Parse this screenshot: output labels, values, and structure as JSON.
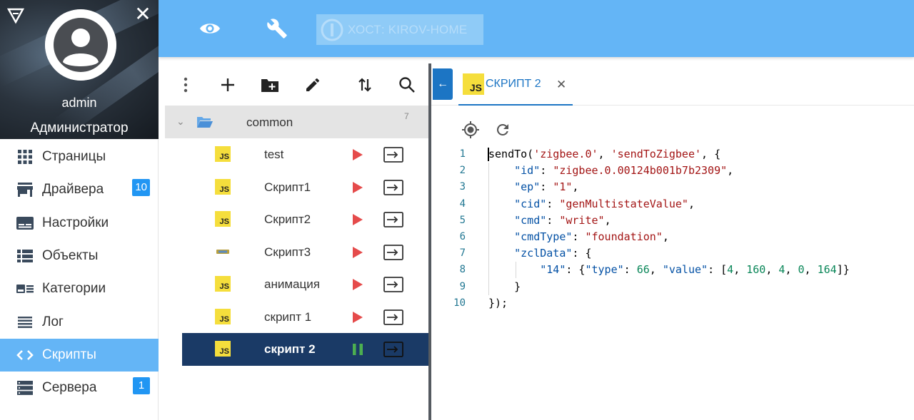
{
  "sidebar": {
    "user": "admin",
    "role": "Администратор",
    "menu": [
      {
        "label": "Страницы",
        "icon": "apps-grid-icon",
        "badge": ""
      },
      {
        "label": "Драйвера",
        "icon": "store-icon",
        "badge": "10"
      },
      {
        "label": "Настройки",
        "icon": "settings-card-icon",
        "badge": ""
      },
      {
        "label": "Объекты",
        "icon": "list-view-icon",
        "badge": ""
      },
      {
        "label": "Категории",
        "icon": "category-icon",
        "badge": ""
      },
      {
        "label": "Лог",
        "icon": "log-lines-icon",
        "badge": ""
      },
      {
        "label": "Скрипты",
        "icon": "code-brackets-icon",
        "badge": ""
      },
      {
        "label": "Сервера",
        "icon": "servers-icon",
        "badge": "1"
      }
    ],
    "active_item": "Скрипты"
  },
  "topbar": {
    "host_label": "ХОСТ: KIROV-HOME",
    "icons": [
      "eye-icon",
      "wrench-icon",
      "iobroker-logo-icon"
    ]
  },
  "tree": {
    "toolbar_icons": [
      "more-vert-icon",
      "add-icon",
      "new-folder-icon",
      "edit-pencil-icon",
      "sort-icon",
      "search-icon"
    ],
    "folder": {
      "name": "common",
      "count": "7"
    },
    "scripts": [
      {
        "name": "test",
        "type": "JS",
        "state": "stopped"
      },
      {
        "name": "Скрипт1",
        "type": "JS",
        "state": "stopped"
      },
      {
        "name": "Скрипт2",
        "type": "JS",
        "state": "stopped"
      },
      {
        "name": "Скрипт3",
        "type": "Blockly",
        "state": "stopped"
      },
      {
        "name": "анимация",
        "type": "JS",
        "state": "stopped"
      },
      {
        "name": "скрипт 1",
        "type": "JS",
        "state": "stopped"
      },
      {
        "name": "скрипт 2",
        "type": "JS",
        "state": "running"
      }
    ]
  },
  "editor": {
    "tab_label": "СКРИПТ 2",
    "tab_type": "JS",
    "tools": [
      "locate-target-icon",
      "refresh-icon"
    ],
    "line_numbers": [
      "1",
      "2",
      "3",
      "4",
      "5",
      "6",
      "7",
      "8",
      "9",
      "10"
    ]
  },
  "colors": {
    "accent": "#64b5f6",
    "selected_row": "#1a3a66",
    "badge": "#2196f3",
    "play_red": "#e54b4b",
    "pause_green": "#4caf50"
  }
}
